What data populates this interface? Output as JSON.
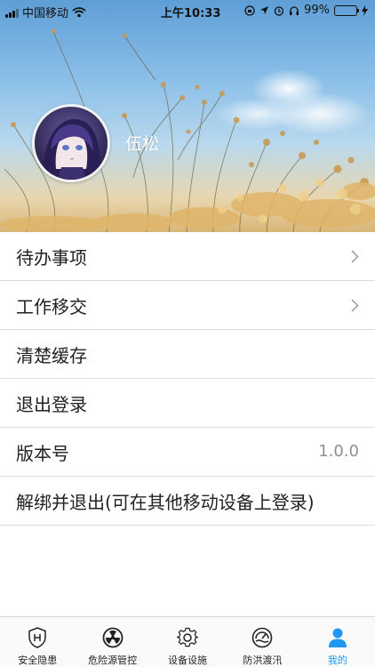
{
  "status_bar": {
    "carrier": "中国移动",
    "time": "上午10:33",
    "battery_percent": "99%",
    "battery_level": 0.99
  },
  "profile": {
    "username": "伍松"
  },
  "menu": {
    "items": [
      {
        "label": "待办事项",
        "has_chevron": true
      },
      {
        "label": "工作移交",
        "has_chevron": true
      },
      {
        "label": "清楚缓存",
        "has_chevron": false
      },
      {
        "label": "退出登录",
        "has_chevron": false
      },
      {
        "label": "版本号",
        "value": "1.0.0"
      },
      {
        "label": "解绑并退出(可在其他移动设备上登录)"
      }
    ]
  },
  "tab_bar": {
    "tabs": [
      {
        "label": "安全隐患",
        "icon": "shield-h-icon"
      },
      {
        "label": "危险源管控",
        "icon": "radiation-icon"
      },
      {
        "label": "设备设施",
        "icon": "gear-icon"
      },
      {
        "label": "防洪渡汛",
        "icon": "gauge-icon"
      },
      {
        "label": "我的",
        "icon": "person-icon",
        "active": true
      }
    ]
  },
  "colors": {
    "accent": "#2196f3",
    "battery": "#30c64a",
    "divider": "#dcdcdc"
  }
}
